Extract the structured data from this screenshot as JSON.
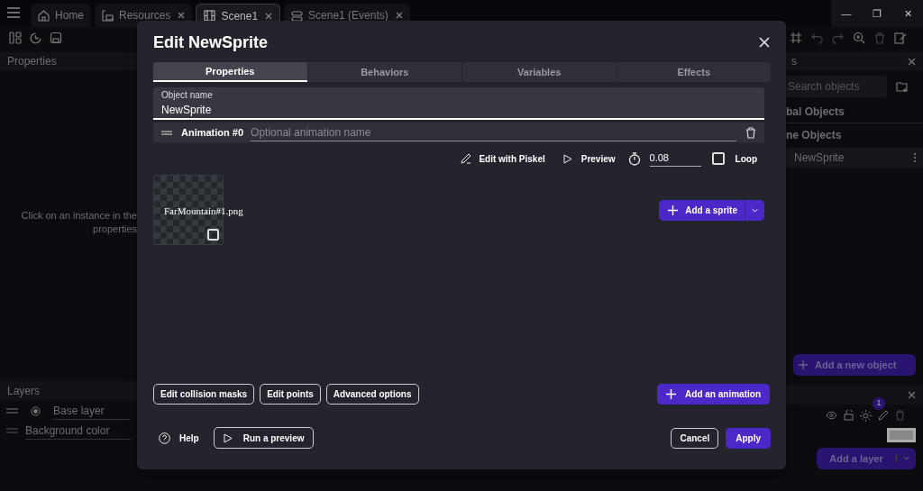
{
  "app_tabs": [
    {
      "label": "Home",
      "closable": false,
      "selected": false
    },
    {
      "label": "Resources",
      "closable": true,
      "selected": false
    },
    {
      "label": "Scene1",
      "closable": true,
      "selected": true
    },
    {
      "label": "Scene1 (Events)",
      "closable": true,
      "selected": false
    }
  ],
  "window_controls": [
    "—",
    "❐",
    "✕"
  ],
  "properties_panel": {
    "title": "Properties",
    "hint": [
      "Click on an instance in the",
      "properties"
    ]
  },
  "layers_panel": {
    "title": "Layers",
    "base_layer": "Base layer",
    "background": "Background color"
  },
  "objects_panel": {
    "title": "s",
    "search_placeholder": "Search objects",
    "groups": [
      "bal Objects",
      "ne Objects"
    ],
    "object": "NewSprite",
    "add_object": "Add a new object",
    "add_layer": "Add a layer",
    "badge": "1"
  },
  "dialog": {
    "title": "Edit NewSprite",
    "tabs": [
      {
        "label": "Properties",
        "selected": true
      },
      {
        "label": "Behaviors",
        "selected": false
      },
      {
        "label": "Variables",
        "selected": false
      },
      {
        "label": "Effects",
        "selected": false
      }
    ],
    "object_name": {
      "label": "Object name",
      "value": "NewSprite"
    },
    "animation": {
      "label": "Animation #0",
      "placeholder": "Optional animation name"
    },
    "toolbar": {
      "edit": "Edit with Piskel",
      "preview": "Preview",
      "interval": "0.08",
      "loop_label": "Loop",
      "loop": false
    },
    "sprites": [
      {
        "name": "FarMountain#1.png",
        "checked": false
      }
    ],
    "add_sprite": "Add a sprite",
    "actions": [
      "Edit collision masks",
      "Edit points",
      "Advanced options"
    ],
    "add_animation": "Add an animation",
    "help": "Help",
    "run_preview": "Run a preview",
    "cancel": "Cancel",
    "apply": "Apply"
  }
}
